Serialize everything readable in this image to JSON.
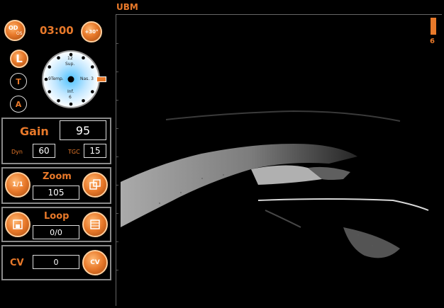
{
  "mode_title": "UBM",
  "probe": {
    "label_top": "OD",
    "label_bottom": "OS"
  },
  "timer": "03:00",
  "angle_button": "+30°",
  "side_buttons": {
    "L": "L",
    "T": "T",
    "A": "A"
  },
  "clock_dial": {
    "top": "12",
    "sup": "Sup.",
    "left": "9Temp.",
    "right": "Nas. 3",
    "inf": "Inf.",
    "bottom": "6"
  },
  "gain": {
    "label": "Gain",
    "value": "95",
    "dyn_label": "Dyn",
    "dyn_value": "60",
    "tgc_label": "TGC",
    "tgc_value": "15"
  },
  "zoom": {
    "label": "Zoom",
    "value": "105"
  },
  "loop": {
    "label": "Loop",
    "value": "0/0"
  },
  "cv": {
    "label": "CV",
    "value": "0",
    "icon_label": "CV"
  },
  "zoom_icon_text": "1/1",
  "scale_indicator": {
    "value": "6"
  },
  "colors": {
    "accent": "#e8792a",
    "background": "#000000"
  }
}
